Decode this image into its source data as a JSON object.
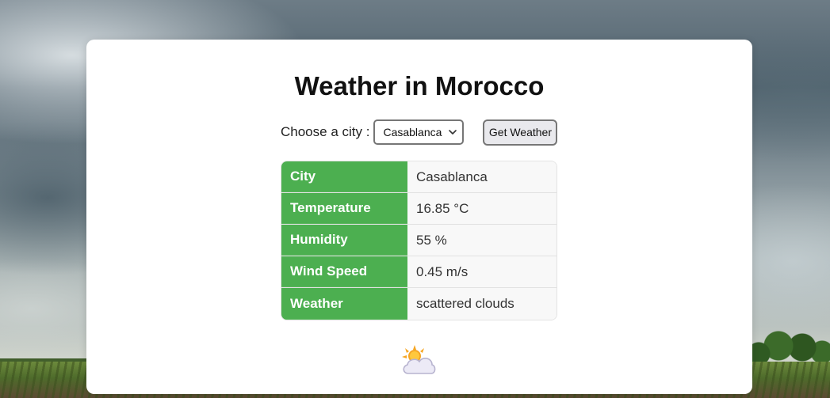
{
  "page": {
    "title": "Weather in Morocco"
  },
  "form": {
    "city_label": "Choose a city :",
    "selected_city": "Casablanca",
    "button_label": "Get Weather"
  },
  "weather_table": [
    {
      "label": "City",
      "value": "Casablanca"
    },
    {
      "label": "Temperature",
      "value": "16.85 °C"
    },
    {
      "label": "Humidity",
      "value": "55 %"
    },
    {
      "label": "Wind Speed",
      "value": "0.45 m/s"
    },
    {
      "label": "Weather",
      "value": "scattered clouds"
    }
  ],
  "icons": {
    "weather_icon": "sun-behind-cloud-icon",
    "dropdown_icon": "chevron-down-icon"
  },
  "colors": {
    "label_column": "#4caf50",
    "value_column": "#f8f8f8",
    "card": "#ffffff"
  }
}
